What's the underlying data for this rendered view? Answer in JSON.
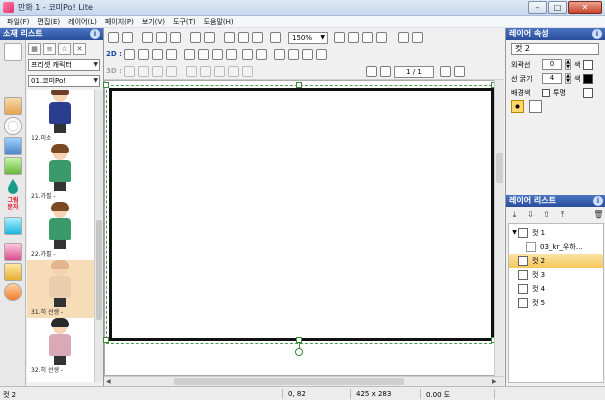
{
  "window": {
    "title": "만화 1 - 코미Po! Lite",
    "buttons": {
      "minimize": "–",
      "maximize": "□",
      "close": "✕"
    }
  },
  "menu": [
    "파일(F)",
    "편집(E)",
    "레이어(L)",
    "페이지(P)",
    "보기(V)",
    "도구(T)",
    "도움말(H)"
  ],
  "left_panel": {
    "header": "소재 리스트",
    "header_icon": "info-icon",
    "tool_labels": {
      "gradation": "그림\n문자"
    },
    "category_select": "프리셋 캐릭터",
    "character_select": "01.코미Po!",
    "items": [
      {
        "label": "12.미소",
        "hair": "#6b3d2a",
        "clothes": "#2a3d8f"
      },
      {
        "label": "21.가필 -",
        "hair": "#7a4a24",
        "clothes": "#3a9a6a"
      },
      {
        "label": "22.가필 -",
        "hair": "#7a4a24",
        "clothes": "#3a9a6a"
      },
      {
        "label": "31.히 선생 -",
        "hair": "#e2b58c",
        "clothes": "#e9cfae",
        "selected": true
      },
      {
        "label": "32.히 선생 -",
        "hair": "#2a2a2a",
        "clothes": "#d9a9b8"
      }
    ]
  },
  "toolbar": {
    "zoom": "150%",
    "label_2d": "2D :",
    "label_3d": "3D :",
    "page_counter": "1 / 1"
  },
  "right_panel": {
    "properties_header": "레이어 속성",
    "name_value": "컷 2",
    "outline_label": "외곽선",
    "outline_value": "0",
    "outline_color_label": "색",
    "thickness_label": "선 굵기",
    "thickness_value": "4",
    "thickness_color_label": "색",
    "background_label": "배경색",
    "transparent_label": "투명",
    "layers_header": "레이어 리스트",
    "layers": [
      {
        "name": "컷 1",
        "level": 0,
        "expanded": true
      },
      {
        "name": "03_kr_우하…",
        "level": 1
      },
      {
        "name": "컷 2",
        "level": 0,
        "active": true
      },
      {
        "name": "컷 3",
        "level": 0
      },
      {
        "name": "컷 4",
        "level": 0
      },
      {
        "name": "컷 5",
        "level": 0
      }
    ]
  },
  "status": {
    "selection": "컷 2",
    "coords": "0, 82",
    "size": "425 x 283",
    "angle": "0.00 도"
  },
  "colors": {
    "title_bar": "#c6d7ec",
    "panel_header": "#2a4f9c",
    "active_layer": "#f4c65a",
    "selection_border": "#4a9a4a"
  }
}
